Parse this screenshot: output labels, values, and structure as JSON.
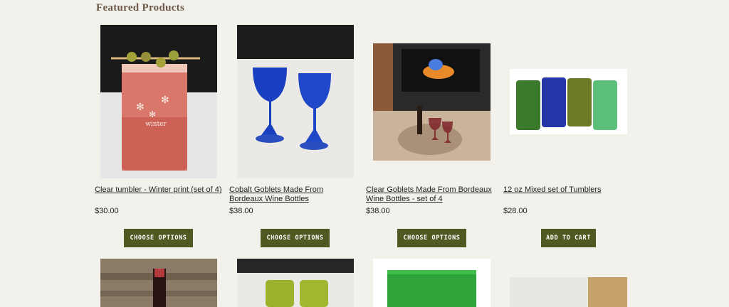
{
  "section": {
    "title": "Featured Products"
  },
  "products": [
    {
      "name": "Clear tumbler - Winter print (set of 4)",
      "price": "$30.00",
      "button": "CHOOSE OPTIONS"
    },
    {
      "name": "Cobalt Goblets Made From Bordeaux Wine Bottles",
      "price": "$38.00",
      "button": "CHOOSE OPTIONS"
    },
    {
      "name": "Clear Goblets Made From Bordeaux Wine Bottles - set of 4",
      "price": "$38.00",
      "button": "CHOOSE OPTIONS"
    },
    {
      "name": "12 oz Mixed set of Tumblers",
      "price": "$28.00",
      "button": "ADD TO CART"
    }
  ],
  "colors": {
    "button": "#4e5a22",
    "title": "#6e5a48",
    "background": "#f3f1ec"
  }
}
